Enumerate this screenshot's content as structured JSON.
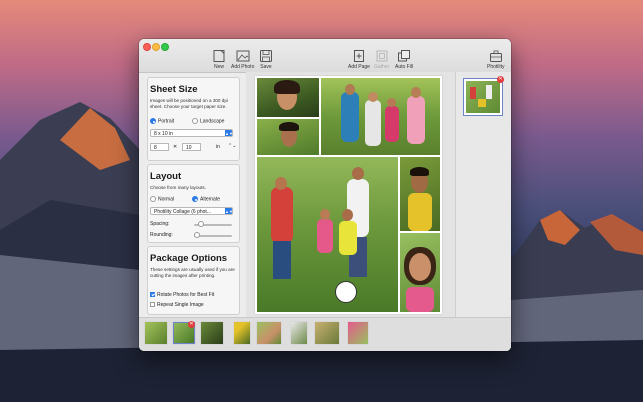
{
  "toolbar": {
    "new_label": "New",
    "add_photo_label": "Add Photo",
    "save_label": "Save",
    "add_page_label": "Add Page",
    "gather_label": "Gather",
    "auto_fill_label": "Auto Fill",
    "photility_label": "Photility"
  },
  "sheet_size": {
    "heading": "Sheet Size",
    "description": "Images will be positioned on a 300 dpi sheet. Choose your target paper size.",
    "orientation_portrait": "Portrait",
    "orientation_landscape": "Landscape",
    "orientation_selected": "Portrait",
    "paper_size": "8 x 10 in",
    "width_value": "8",
    "times_symbol": "✕",
    "height_value": "10",
    "unit": "in"
  },
  "layout": {
    "heading": "Layout",
    "description": "Choose from many layouts.",
    "mode_normal": "Normal",
    "mode_alternate": "Alternate",
    "mode_selected": "Alternate",
    "layout_select": "Photility Collage (6 phot...",
    "spacing_label": "Spacing:",
    "rounding_label": "Rounding:",
    "spacing_level": 0.12,
    "rounding_level": 0.0
  },
  "package_options": {
    "heading": "Package Options",
    "description": "These settings are usually used if you are cutting the images after printing.",
    "rotate_label": "Rotate Photos for Best Fit",
    "rotate_checked": true,
    "repeat_label": "Repeat Single Image",
    "repeat_checked": false
  },
  "icons": {
    "remove_badge": "✕",
    "select_arrows": "▲▼",
    "stepper_arrows": "⌃⌄"
  },
  "colors": {
    "accent": "#2a79e7",
    "remove_badge": "#e23b3b",
    "selected_thumb_border": "#6d83c9"
  }
}
